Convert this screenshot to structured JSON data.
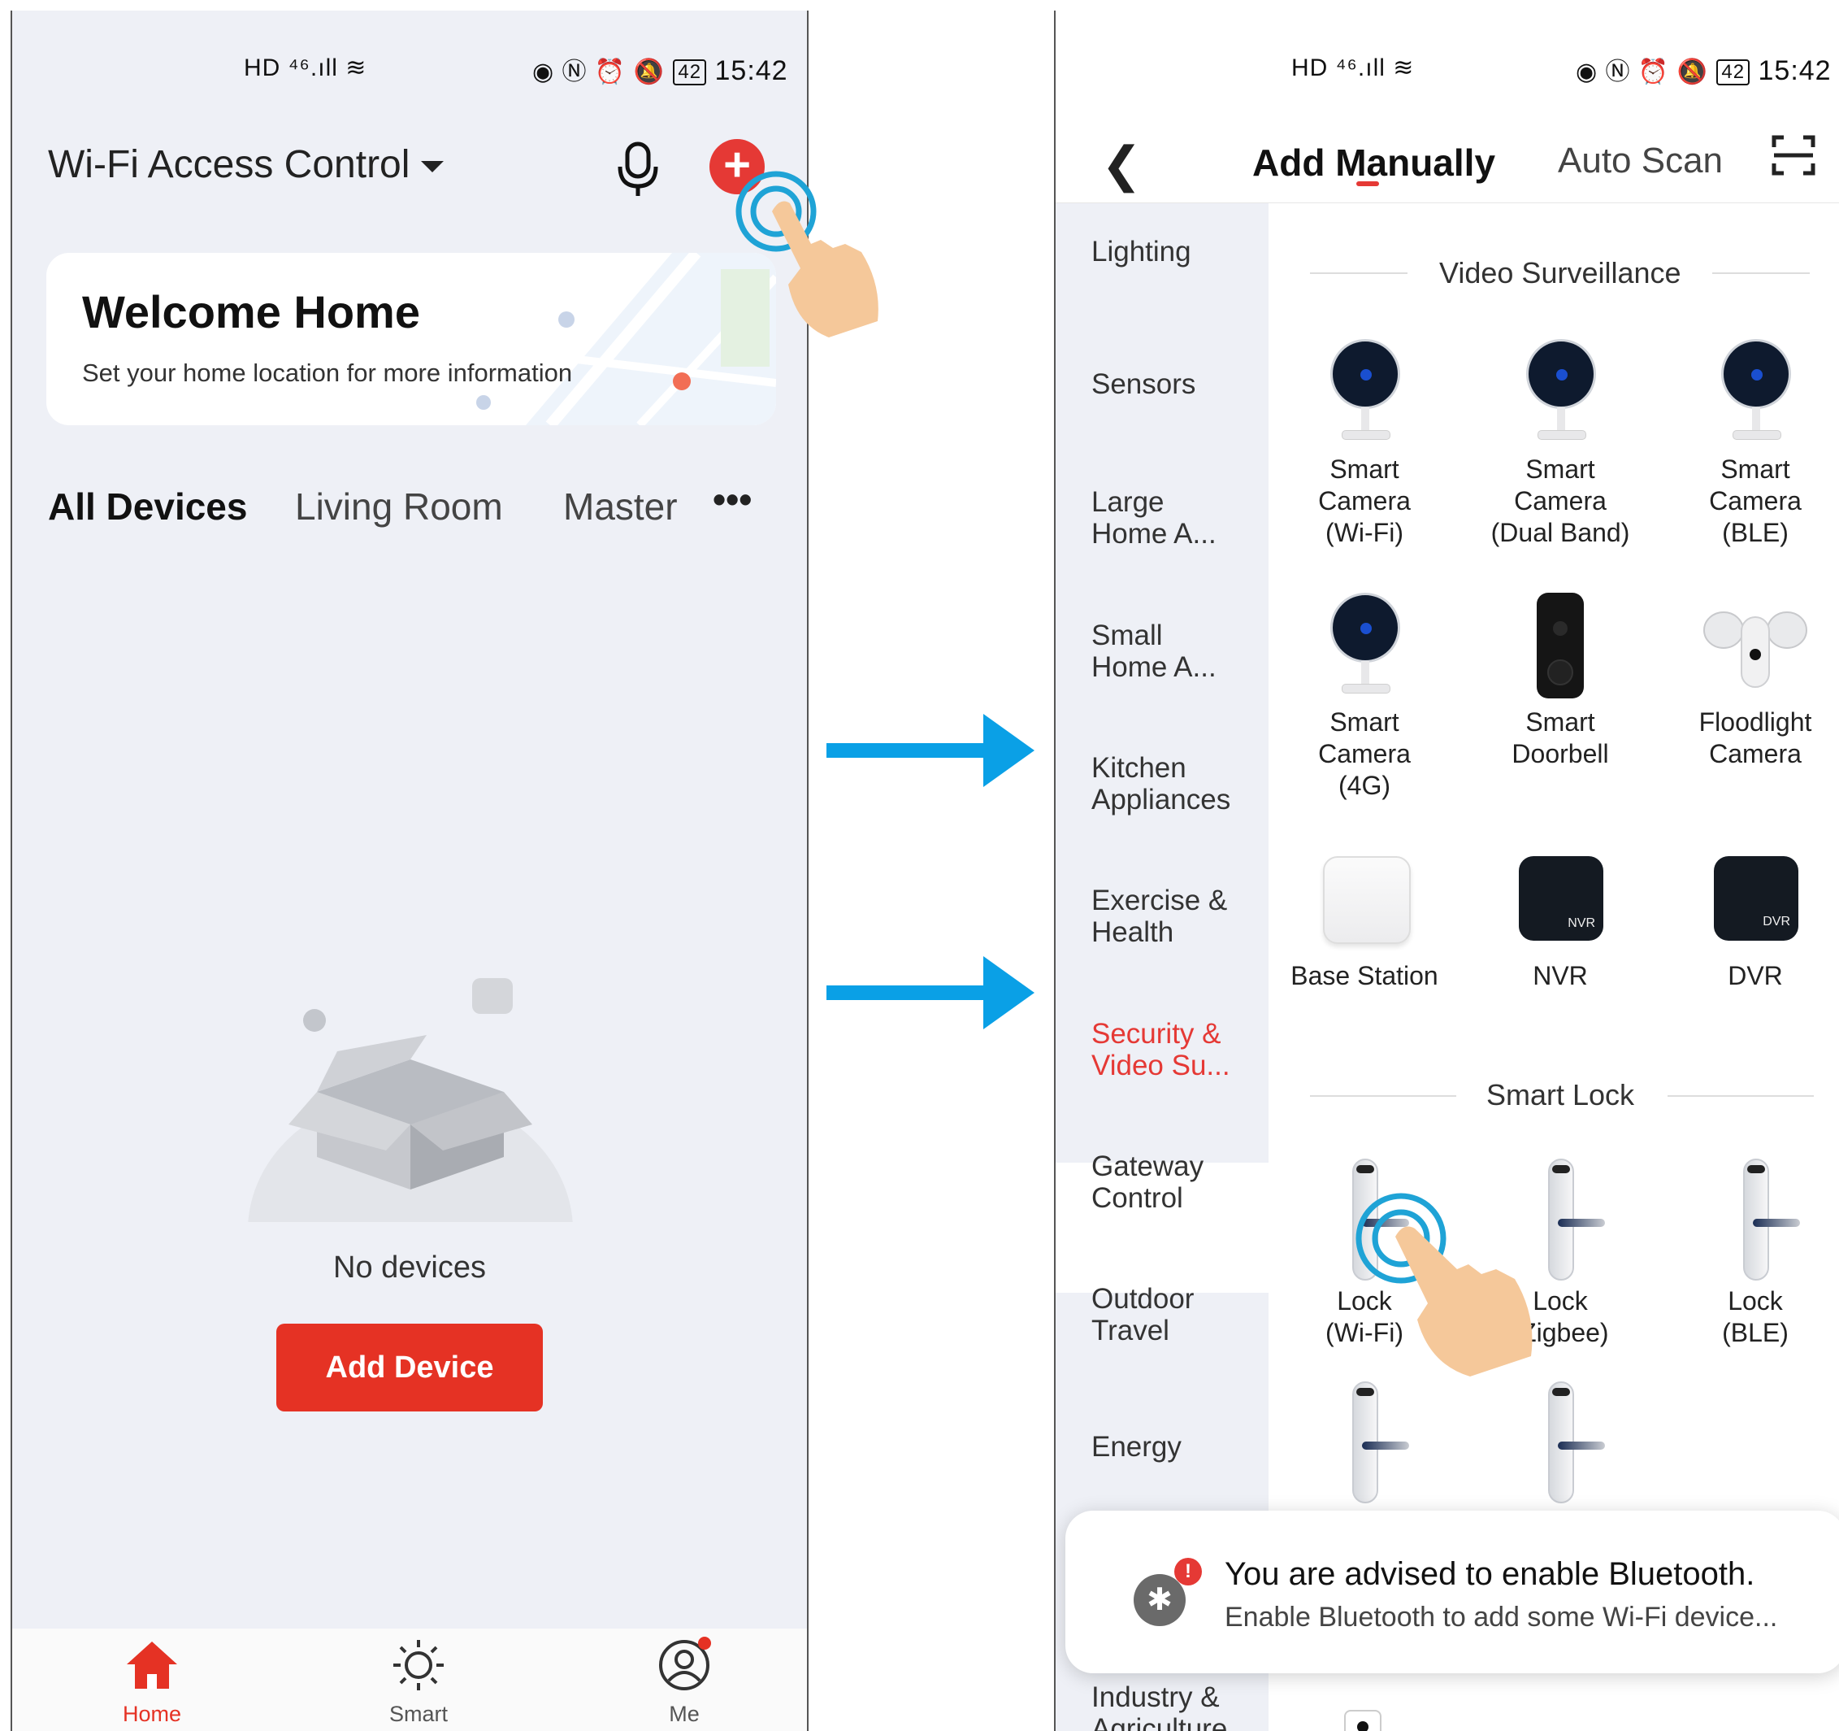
{
  "left_screen": {
    "status": {
      "left_icons": "HD ⁴⁶.ıll ≋",
      "right_icons": "◉ Ⓝ ⏰ 🔕",
      "battery": "42",
      "time": "15:42"
    },
    "home_name": "Wi-Fi Access Control",
    "welcome": {
      "title": "Welcome Home",
      "subtitle": "Set your home location for more information"
    },
    "tabs": [
      "All Devices",
      "Living Room",
      "Master"
    ],
    "more": "•••",
    "empty_text": "No devices",
    "add_device_label": "Add Device",
    "bottom_nav": [
      "Home",
      "Smart",
      "Me"
    ],
    "accent": "#e53935"
  },
  "right_screen": {
    "status": {
      "left_icons": "HD ⁴⁶.ıll ≋",
      "right_icons": "◉ Ⓝ ⏰ 🔕",
      "battery": "42",
      "time": "15:42"
    },
    "tabs": {
      "active": "Add Manually",
      "other": "Auto Scan"
    },
    "categories": [
      "Lighting",
      "Sensors",
      "Large Home A...",
      "Small Home A...",
      "Kitchen Appliances",
      "Exercise & Health",
      "Security & Video Su...",
      "Gateway Control",
      "Outdoor Travel",
      "Energy",
      "Industry & Agriculture"
    ],
    "active_category": "Security & Video Su...",
    "sections": {
      "video": {
        "title": "Video Surveillance",
        "items": [
          [
            "Smart",
            "Camera",
            "(Wi-Fi)"
          ],
          [
            "Smart",
            "Camera",
            "(Dual Band)"
          ],
          [
            "Smart",
            "Camera",
            "(BLE)"
          ],
          [
            "Smart",
            "Camera",
            "(4G)"
          ],
          [
            "Smart",
            "Doorbell"
          ],
          [
            "Floodlight",
            "Camera"
          ],
          [
            "Base Station"
          ],
          [
            "NVR"
          ],
          [
            "DVR"
          ]
        ],
        "nvr_badge": "NVR",
        "dvr_badge": "DVR"
      },
      "lock": {
        "title": "Smart Lock",
        "items": [
          [
            "Lock",
            "(Wi-Fi)"
          ],
          [
            "Lock",
            "(Zigbee)"
          ],
          [
            "Lock",
            "(BLE)"
          ]
        ]
      }
    },
    "toast": {
      "title": "You are advised to enable Bluetooth.",
      "message": "Enable Bluetooth to add some Wi-Fi device...",
      "badge": "!"
    }
  },
  "arrow_color": "#0aa0e6",
  "touch_color": "#f5c89a",
  "ripple_color": "#1fa3d6"
}
